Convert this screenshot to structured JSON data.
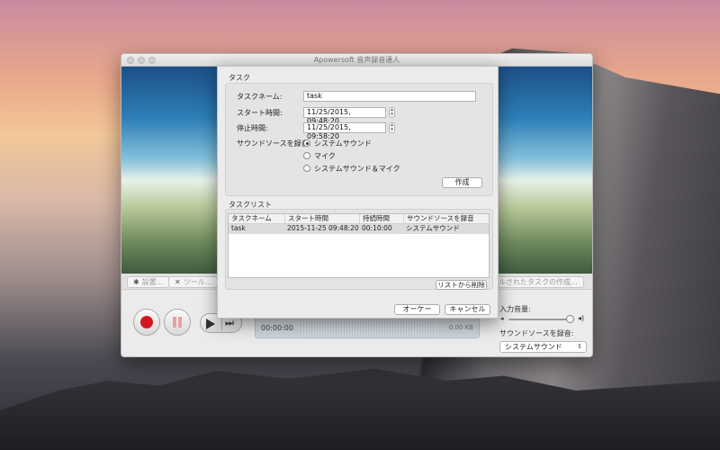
{
  "window": {
    "title": "Apowersoft 音声録音達人"
  },
  "toolbar": {
    "settings_label": "設置...",
    "tools_label": "ツール...",
    "created_task_label": "ールされたタスクの作成..."
  },
  "player": {
    "elapsed": "00:00:00",
    "size": "0.00 KB"
  },
  "audio": {
    "volume_label": "入力音量:",
    "source_label": "サウンドソースを録音:",
    "source_value": "システムサウンド"
  },
  "dialog": {
    "task_group_title": "タスク",
    "task_name_label": "タスクネーム:",
    "task_name_value": "task",
    "start_label": "スタート時間:",
    "start_value": "11/25/2015, 09:48:20",
    "stop_label": "停止時間:",
    "stop_value": "11/25/2015, 09:58:20",
    "source_label": "サウンドソースを録音:",
    "source_options": [
      "システムサウンド",
      "マイク",
      "システムサウンド＆マイク"
    ],
    "create_button": "作成",
    "list_group_title": "タスクリスト",
    "columns": [
      "タスクネーム",
      "スタート時間",
      "持続時間",
      "サウンドソースを録音"
    ],
    "rows": [
      [
        "task",
        "2015-11-25 09:48:20",
        "00:10:00",
        "システムサウンド"
      ]
    ],
    "remove_button": "リストから削除",
    "ok_button": "オーケー",
    "cancel_button": "キャンセル"
  },
  "icons": {
    "settings": "gear-icon",
    "tools": "wrench-icon",
    "record": "record-icon",
    "pause": "pause-icon",
    "play": "play-icon",
    "next": "skip-next-icon",
    "clock": "clock-icon",
    "volume_low": "speaker-low-icon",
    "volume_high": "speaker-high-icon"
  },
  "colors": {
    "record": "#d01820",
    "accent": "#3a6ea8"
  }
}
